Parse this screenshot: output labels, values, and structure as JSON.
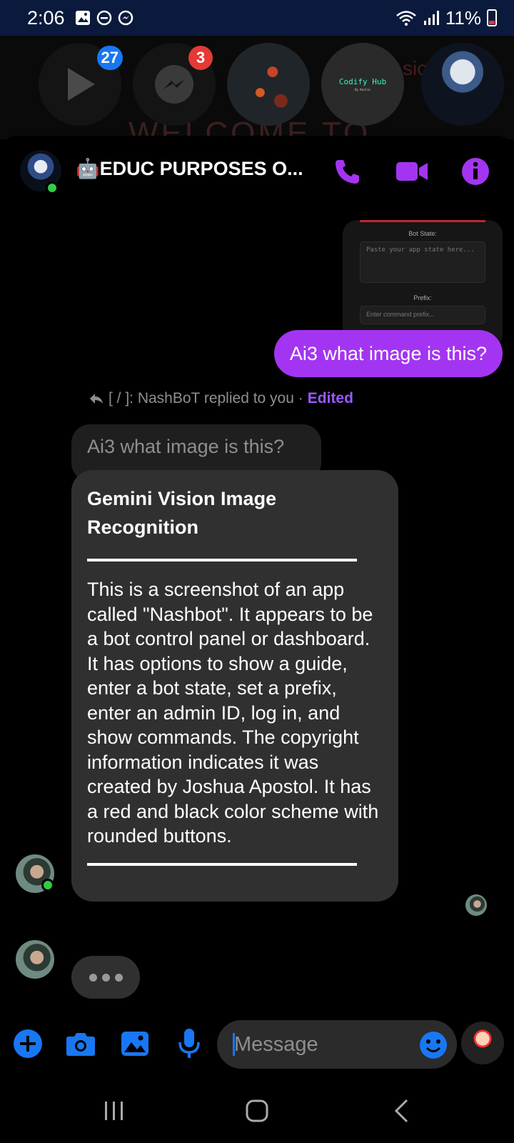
{
  "status_bar": {
    "time": "2:06",
    "battery_percent": "11%",
    "icons": [
      "image-icon",
      "dnd-icon",
      "messenger-icon",
      "wifi-icon",
      "signal-icon",
      "battery-icon"
    ]
  },
  "chat_heads": {
    "badges": [
      "27",
      "3"
    ],
    "codify_title": "Codify Hub",
    "codify_sub": "By Kenlie",
    "background_text": "WELCOME TO",
    "background_fragment": "sic"
  },
  "header": {
    "title": "🤖EDUC PURPOSES O...",
    "call_icon": "phone-icon",
    "video_icon": "video-icon",
    "info_icon": "info-icon"
  },
  "thumbnail": {
    "bot_state_label": "Bot State:",
    "bot_state_placeholder": "Paste your app state here...",
    "prefix_label": "Prefix:",
    "prefix_placeholder": "Enter command prefix..."
  },
  "messages": {
    "sent_text": "Ai3 what image is this?",
    "reply_note": "[ / ]: NashBoT replied to you · ",
    "reply_note_edited": "Edited",
    "quoted_text": "Ai3 what image is this?",
    "reply_title": "Gemini Vision Image Recognition",
    "reply_body": "This is a screenshot of an app called \"Nashbot\".  It appears to be a bot control panel or dashboard. It has options to show a guide, enter a bot state, set a prefix, enter an admin ID, log in, and show commands. The copyright information indicates it was created by Joshua Apostol.  It has a red and black color scheme with rounded buttons."
  },
  "composer": {
    "placeholder": "Message"
  },
  "colors": {
    "accent": "#a335f2",
    "link_blue": "#1877f2",
    "online": "#31cc46"
  }
}
